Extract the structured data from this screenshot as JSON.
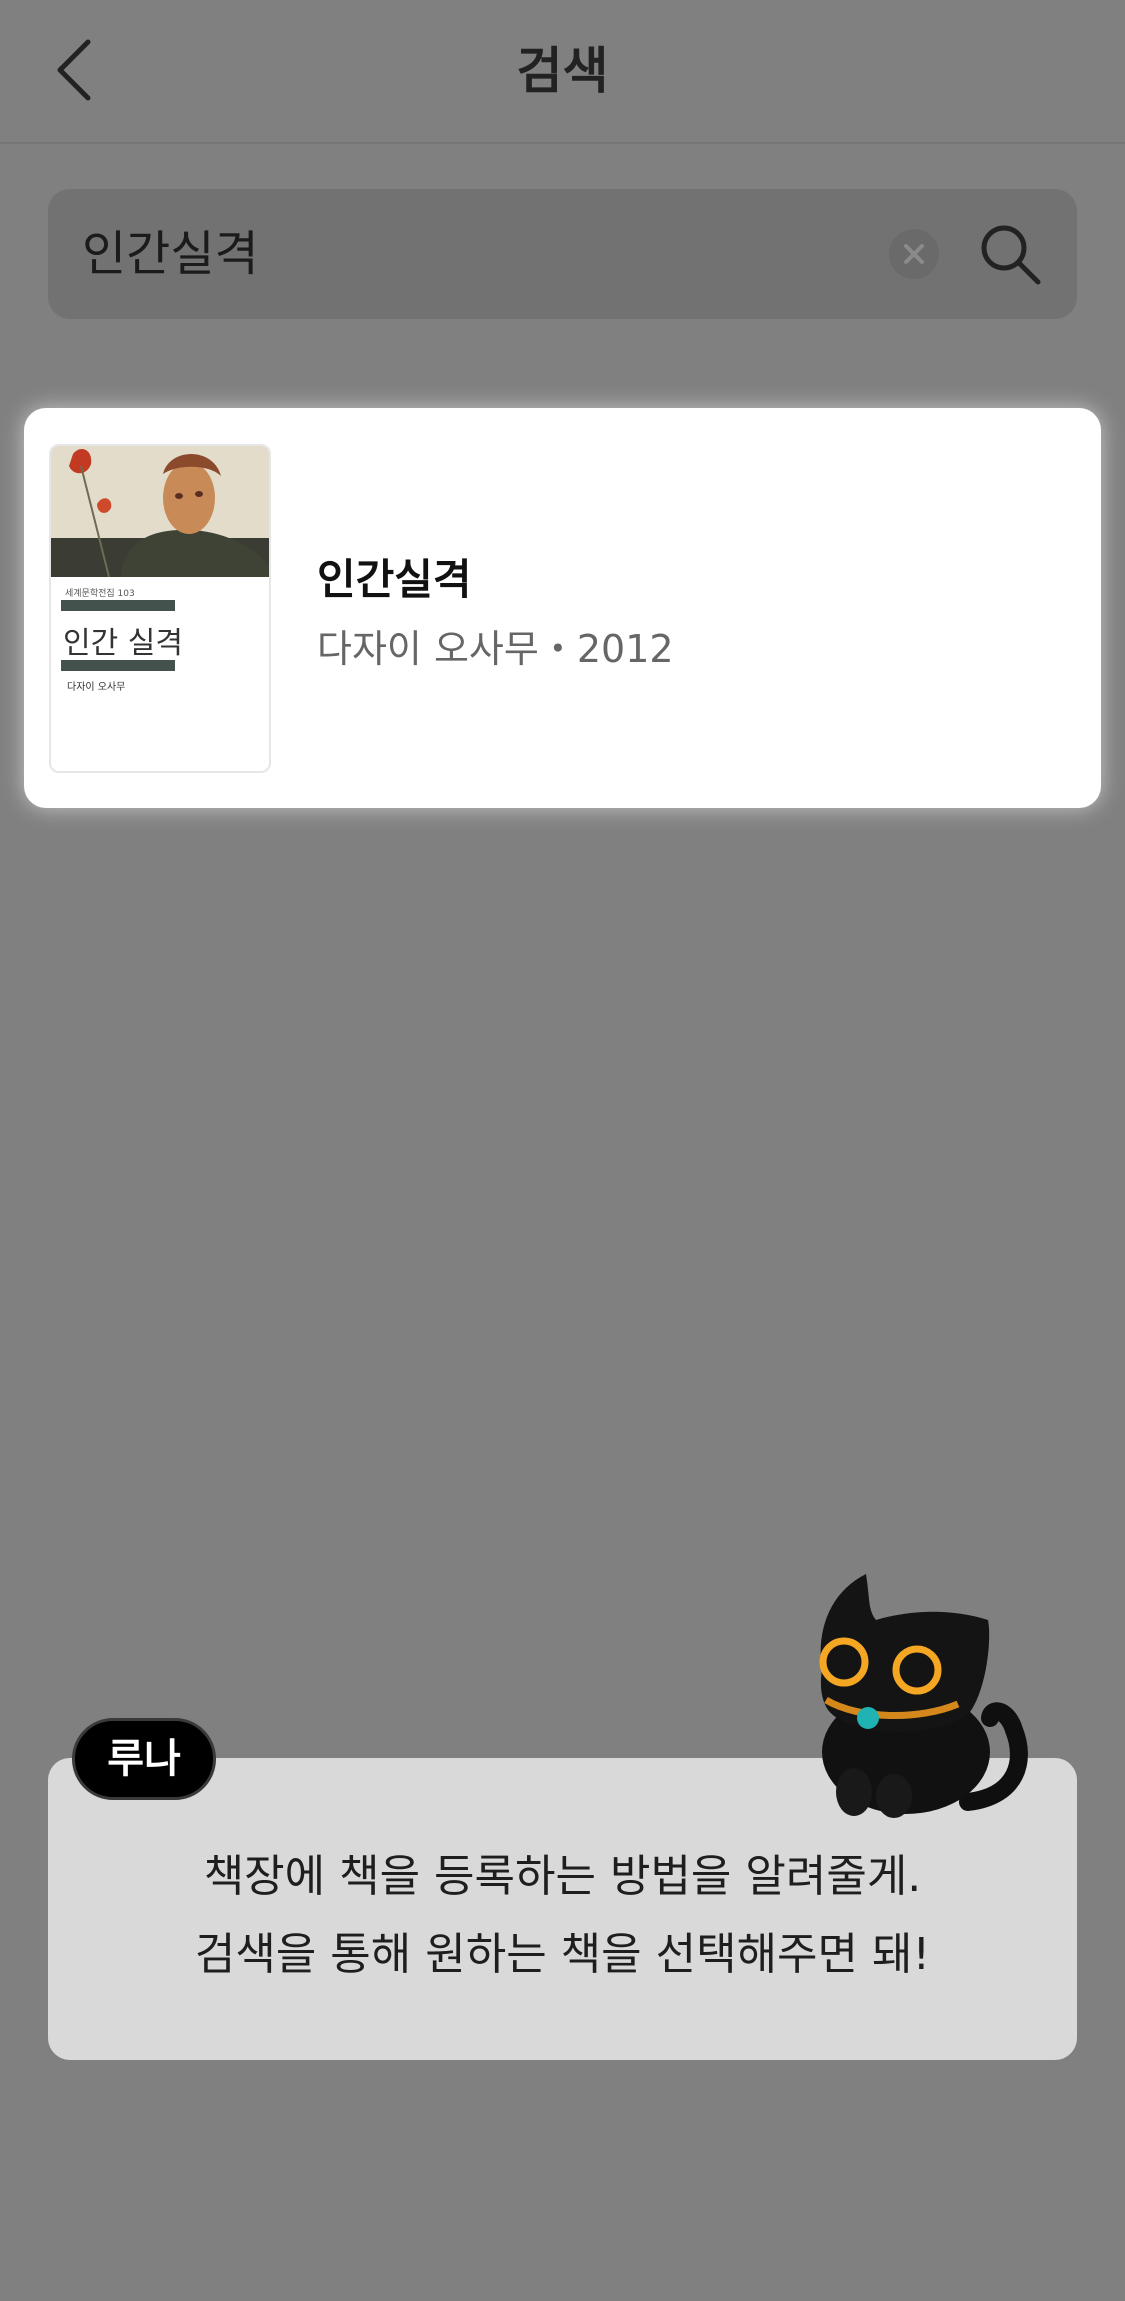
{
  "header": {
    "title": "검색",
    "back_icon": "chevron-left-icon"
  },
  "search": {
    "value": "인간실격",
    "clear_icon": "close-circle-icon",
    "search_icon": "magnifier-icon"
  },
  "results": [
    {
      "title": "인간실격",
      "meta": "다자이 오사무・2012",
      "cover": {
        "series": "세계문학전집 103",
        "title": "인간 실격",
        "author": "다자이 오사무"
      }
    }
  ],
  "guide": {
    "speaker": "루나",
    "line1": "책장에 책을 등록하는 방법을 알려줄게.",
    "line2": "검색을 통해 원하는 책을 선택해주면 돼!",
    "character_icon": "black-cat-icon"
  },
  "colors": {
    "overlay": "#808080",
    "card": "#ffffff",
    "bubble": "#d9d9d9",
    "cat_eye": "#f5a623",
    "collar_gem": "#1fb3b3"
  }
}
